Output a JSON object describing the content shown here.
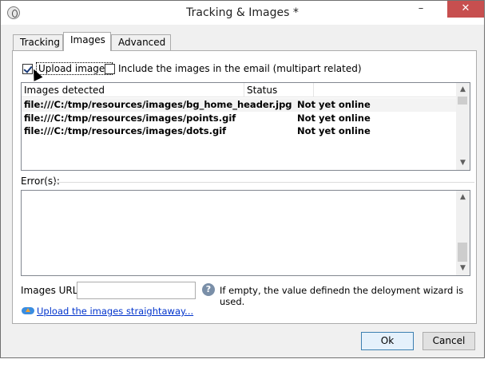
{
  "window": {
    "title": "Tracking & Images *",
    "controls": {
      "minimize": "–",
      "maximize": "☐",
      "close": "✕"
    }
  },
  "tabs": [
    {
      "label": "Tracking",
      "active": false
    },
    {
      "label": "Images",
      "active": true
    },
    {
      "label": "Advanced",
      "active": false
    }
  ],
  "options": {
    "upload_images": {
      "label": "Upload images",
      "checked": true
    },
    "include_images": {
      "label": "Include the images in the email (multipart related)",
      "checked": false
    }
  },
  "image_list": {
    "columns": [
      "Images detected",
      "Status"
    ],
    "rows": [
      {
        "path": "file:///C:/tmp/resources/images/bg_home_header.jpg",
        "status": "Not yet online"
      },
      {
        "path": "file:///C:/tmp/resources/images/points.gif",
        "status": "Not yet online"
      },
      {
        "path": "file:///C:/tmp/resources/images/dots.gif",
        "status": "Not yet online"
      }
    ]
  },
  "errors": {
    "label": "Error(s):"
  },
  "images_url": {
    "label": "Images URL:",
    "value": "",
    "help_text": "If empty, the value definedn the deloyment wizard is used."
  },
  "upload_link": {
    "label": "Upload the images straightaway..."
  },
  "buttons": {
    "ok": "Ok",
    "cancel": "Cancel"
  },
  "icons": {
    "app": "app-icon",
    "help": "help-icon",
    "upload": "upload-cloud-icon"
  },
  "colors": {
    "close_button": "#c74f4f",
    "link": "#0033cc",
    "ok_border": "#3c7fb1"
  }
}
